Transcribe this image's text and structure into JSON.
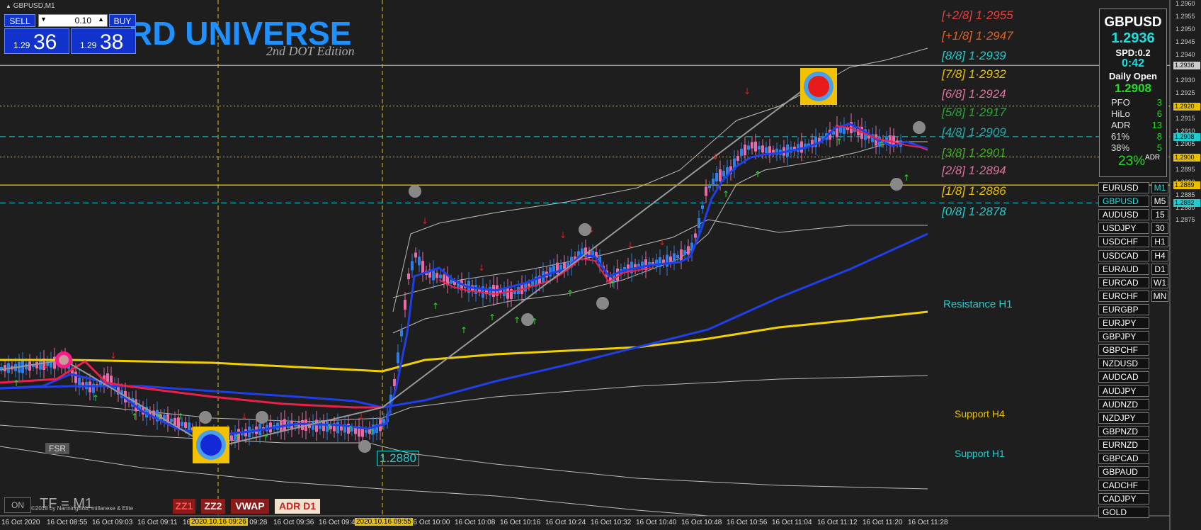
{
  "window": {
    "symbol_title": "GBPUSD,M1"
  },
  "brand": {
    "title": "RD UNIVERSE",
    "subtitle": "2nd DOT Edition"
  },
  "trade_panel": {
    "sell_label": "SELL",
    "buy_label": "BUY",
    "lot_value": "0.10",
    "sell_small": "1.29",
    "sell_big": "36",
    "buy_small": "1.29",
    "buy_big": "38"
  },
  "info_box": {
    "symbol": "GBPUSD",
    "price": "1.2936",
    "spread": "SPD:0.2",
    "timer": "0:42",
    "daily_open_label": "Daily Open",
    "daily_open": "1.2908",
    "rows": [
      {
        "k": "PFO",
        "v": "3"
      },
      {
        "k": "HiLo",
        "v": "6"
      },
      {
        "k": "ADR",
        "v": "13"
      },
      {
        "k": "61%",
        "v": "8"
      },
      {
        "k": "38%",
        "v": "5"
      }
    ],
    "adr_pct": "23%",
    "adr_tag": "ADR"
  },
  "symbols": [
    "EURUSD",
    "GBPUSD",
    "AUDUSD",
    "USDJPY",
    "USDCHF",
    "USDCAD",
    "EURAUD",
    "EURCAD",
    "EURCHF",
    "EURGBP",
    "EURJPY",
    "GBPJPY",
    "GBPCHF",
    "NZDUSD",
    "AUDCAD",
    "AUDJPY",
    "AUDNZD",
    "NZDJPY",
    "GBPNZD",
    "EURNZD",
    "GBPCAD",
    "GBPAUD",
    "CADCHF",
    "CADJPY",
    "GOLD"
  ],
  "active_symbol": "GBPUSD",
  "timeframes": [
    "M1",
    "M5",
    "15",
    "30",
    "H1",
    "H4",
    "D1",
    "W1",
    "MN"
  ],
  "active_timeframe": "M1",
  "murrey_levels": [
    {
      "label": "[+2/8]  1·2955",
      "price": 1.2955,
      "color": "#e04040"
    },
    {
      "label": "[+1/8]  1·2947",
      "price": 1.2947,
      "color": "#e06020"
    },
    {
      "label": "[8/8]  1·2939",
      "price": 1.2939,
      "color": "#22cccc"
    },
    {
      "label": "[7/8]  1·2932",
      "price": 1.2932,
      "color": "#e8c000"
    },
    {
      "label": "[6/8]  1·2924",
      "price": 1.2924,
      "color": "#e070a0"
    },
    {
      "label": "[5/8]  1·2917",
      "price": 1.2917,
      "color": "#22aa33"
    },
    {
      "label": "[4/8]  1·2909",
      "price": 1.2909,
      "color": "#22aaaa"
    },
    {
      "label": "[3/8]  1·2901",
      "price": 1.2901,
      "color": "#44aa22"
    },
    {
      "label": "[2/8]  1·2894",
      "price": 1.2894,
      "color": "#e070a0"
    },
    {
      "label": "[1/8]  1·2886",
      "price": 1.2886,
      "color": "#e8c000"
    },
    {
      "label": "[0/8]  1·2878",
      "price": 1.2878,
      "color": "#22cccc"
    }
  ],
  "sr_labels": {
    "resistance_h1": "Resistance H1",
    "support_h4": "Support H4",
    "support_h1": "Support H1"
  },
  "price_axis": {
    "ticks": [
      "1.2960",
      "1.2955",
      "1.2950",
      "1.2945",
      "1.2940",
      "1.2935",
      "1.2930",
      "1.2925",
      "1.2920",
      "1.2915",
      "1.2910",
      "1.2905",
      "1.2900",
      "1.2895",
      "1.2890",
      "1.2885",
      "1.2880",
      "1.2875"
    ],
    "tags": [
      {
        "text": "1.2936",
        "price": 1.2936,
        "color": "#cccccc"
      },
      {
        "text": "1.2920",
        "price": 1.292,
        "color": "#e8c000"
      },
      {
        "text": "1.2908",
        "price": 1.2908,
        "color": "#22cccc"
      },
      {
        "text": "1.2900",
        "price": 1.29,
        "color": "#e8c000"
      },
      {
        "text": "1.2889",
        "price": 1.2889,
        "color": "#e8c000"
      },
      {
        "text": "1.2882",
        "price": 1.2882,
        "color": "#22cccc"
      }
    ]
  },
  "time_axis": [
    "16 Oct 2020",
    "16 Oct 08:55",
    "16 Oct 09:03",
    "16 Oct 09:11",
    "16 Oct 09:19",
    "16 Oct 09:28",
    "16 Oct 09:36",
    "16 Oct 09:44",
    "16 Oct 09:52",
    "16 Oct 10:00",
    "16 Oct 10:08",
    "16 Oct 10:16",
    "16 Oct 10:24",
    "16 Oct 10:32",
    "16 Oct 10:40",
    "16 Oct 10:48",
    "16 Oct 10:56",
    "16 Oct 11:04",
    "16 Oct 11:12",
    "16 Oct 11:20",
    "16 Oct 11:28"
  ],
  "time_highlights": [
    "2020.10.16 09:26",
    "2020.10.16 09:55"
  ],
  "price_label_low": "1.2880",
  "fsr_label": "FSR",
  "on_label": "ON",
  "tf_label": "TF = M1",
  "copyright": "©2018 by NanningBob, millanese & Elite",
  "bottom_buttons": [
    "ZZ1",
    "ZZ2",
    "VWAP",
    "ADR D1"
  ]
}
